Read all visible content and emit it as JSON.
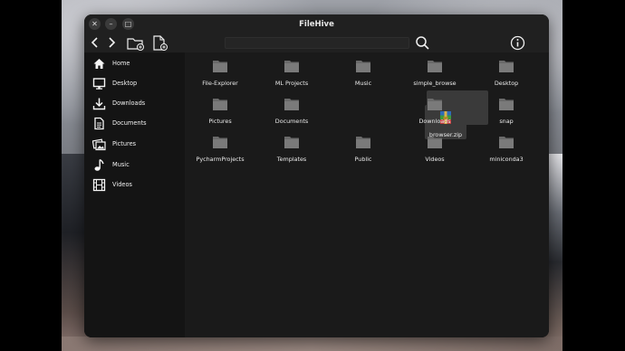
{
  "window": {
    "title": "FileHive"
  },
  "titlebar_buttons": {
    "close": "✕",
    "minimize": "–",
    "maximize": "□"
  },
  "sidebar": {
    "items": [
      {
        "label": "Home",
        "icon": "home-icon"
      },
      {
        "label": "Desktop",
        "icon": "monitor-icon"
      },
      {
        "label": "Downloads",
        "icon": "download-icon"
      },
      {
        "label": "Documents",
        "icon": "document-icon"
      },
      {
        "label": "Pictures",
        "icon": "pictures-icon"
      },
      {
        "label": "Music",
        "icon": "music-note-icon"
      },
      {
        "label": "Videos",
        "icon": "film-icon"
      }
    ]
  },
  "files": [
    {
      "name": "File-Explorer",
      "type": "folder"
    },
    {
      "name": "ML Projects",
      "type": "folder"
    },
    {
      "name": "Music",
      "type": "folder"
    },
    {
      "name": "simple_browse",
      "type": "folder"
    },
    {
      "name": "Desktop",
      "type": "folder"
    },
    {
      "name": "Pictures",
      "type": "folder"
    },
    {
      "name": "Documents",
      "type": "folder"
    },
    {
      "name": "browser.zip",
      "type": "archive",
      "selected": true
    },
    {
      "name": "Downloads",
      "type": "folder"
    },
    {
      "name": "snap",
      "type": "folder"
    },
    {
      "name": "PycharmProjects",
      "type": "folder"
    },
    {
      "name": "Templates",
      "type": "folder"
    },
    {
      "name": "Public",
      "type": "folder"
    },
    {
      "name": "Videos",
      "type": "folder"
    },
    {
      "name": "miniconda3",
      "type": "folder"
    }
  ],
  "colors": {
    "window_bg": "#141414",
    "titlebar_bg": "#202020",
    "content_bg": "#1a1a1a",
    "folder_gray": "#6a6a6a",
    "selected_bg": "#3a3a3a"
  }
}
